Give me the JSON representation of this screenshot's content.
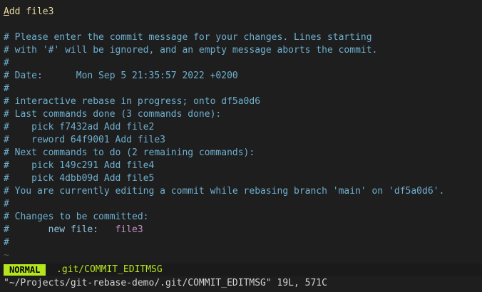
{
  "buffer": {
    "subject": "Add file3",
    "lines": [
      "",
      "# Please enter the commit message for your changes. Lines starting",
      "# with '#' will be ignored, and an empty message aborts the commit.",
      "#",
      "# Date:      Mon Sep 5 21:35:57 2022 +0200",
      "#",
      "# interactive rebase in progress; onto df5a0d6",
      "# Last commands done (3 commands done):",
      "#    pick f7432ad Add file2",
      "#    reword 64f9001 Add file3",
      "# Next commands to do (2 remaining commands):",
      "#    pick 149c291 Add file4",
      "#    pick 4dbb09d Add file5",
      "# You are currently editing a commit while rebasing branch 'main' on 'df5a0d6'.",
      "#",
      "# Changes to be committed:"
    ],
    "change_prefix": "#       ",
    "change_status": "new file:",
    "change_gap": "   ",
    "change_file": "file3",
    "trailing_comments": [
      "#",
      "#"
    ],
    "empty_marker": "~"
  },
  "statusline": {
    "mode": "NORMAL",
    "file": ".git/COMMIT_EDITMSG"
  },
  "cmdline": {
    "message": "\"~/Projects/git-rebase-demo/.git/COMMIT_EDITMSG\" 19L, 571C"
  },
  "colors": {
    "background": "#1e1e1e",
    "comment": "#6fb0d0",
    "subject": "#e8d9a0",
    "mode_bg": "#b5e61d",
    "filename": "#c58fc0"
  }
}
